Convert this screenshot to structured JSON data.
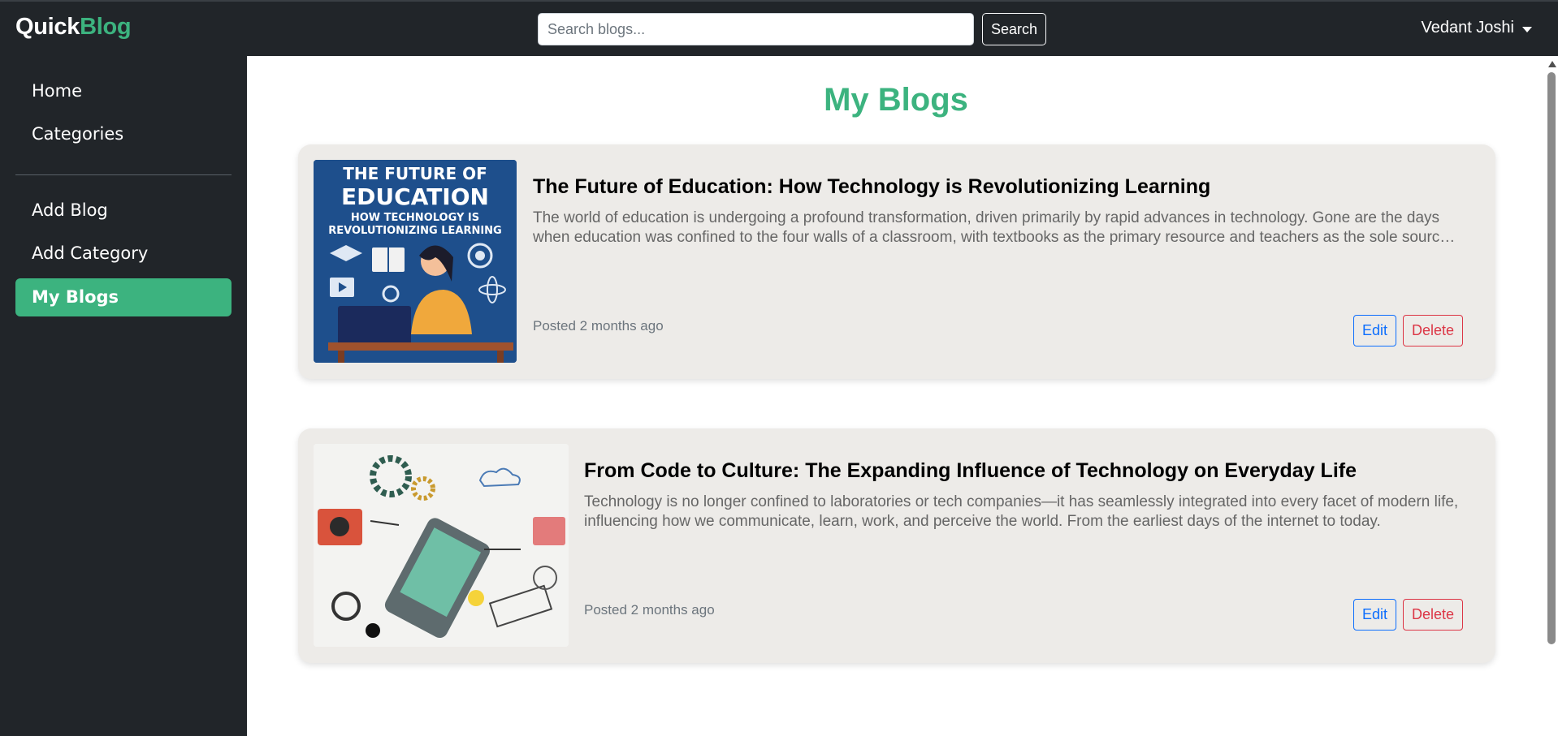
{
  "brand": {
    "part1": "Quick",
    "part2": "Blog"
  },
  "search": {
    "placeholder": "Search blogs...",
    "value": "",
    "button_label": "Search"
  },
  "user": {
    "name": "Vedant Joshi"
  },
  "sidebar": {
    "items": [
      {
        "label": "Home"
      },
      {
        "label": "Categories"
      },
      {
        "label": "Add Blog"
      },
      {
        "label": "Add Category"
      },
      {
        "label": "My Blogs",
        "active": true
      }
    ]
  },
  "main": {
    "title": "My Blogs",
    "blogs": [
      {
        "title": "The Future of Education: How Technology is Revolutionizing Learning",
        "excerpt": "The world of education is undergoing a profound transformation, driven primarily by rapid advances in technology. Gone are the days when education was confined to the four walls of a classroom, with textbooks as the primary resource and teachers as the sole source of knowledge.",
        "posted": "Posted 2 months ago",
        "edit_label": "Edit",
        "delete_label": "Delete",
        "image_text": {
          "line1": "THE FUTURE OF",
          "line2": "EDUCATION",
          "line3": "HOW TECHNOLOGY IS",
          "line4": "REVOLUTIONIZING LEARNING"
        }
      },
      {
        "title": "From Code to Culture: The Expanding Influence of Technology on Everyday Life",
        "excerpt": "Technology is no longer confined to laboratories or tech companies—it has seamlessly integrated into every facet of modern life, influencing how we communicate, learn, work, and perceive the world. From the earliest days of the internet to today.",
        "posted": "Posted 2 months ago",
        "edit_label": "Edit",
        "delete_label": "Delete"
      }
    ]
  },
  "colors": {
    "accent": "#3cb37f",
    "dark": "#212529",
    "card_bg": "#edebe8",
    "edit": "#0d6efd",
    "delete": "#dc3545"
  }
}
